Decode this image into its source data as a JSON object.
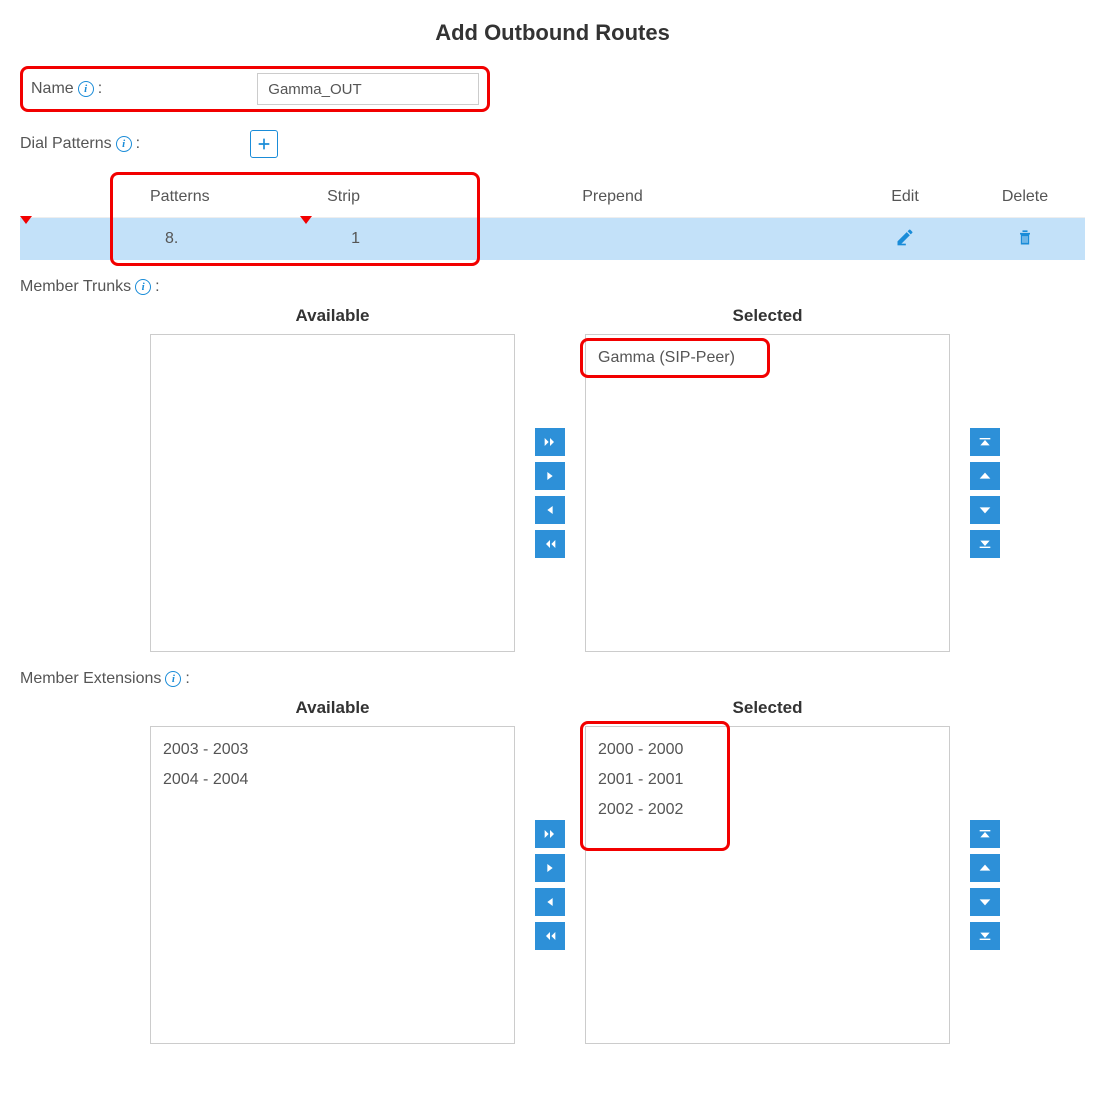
{
  "title": "Add Outbound Routes",
  "fields": {
    "name_label": "Name",
    "name_value": "Gamma_OUT",
    "dial_patterns_label": "Dial Patterns",
    "member_trunks_label": "Member Trunks",
    "member_extensions_label": "Member Extensions"
  },
  "dial_patterns_table": {
    "headers": {
      "patterns": "Patterns",
      "strip": "Strip",
      "prepend": "Prepend",
      "edit": "Edit",
      "delete": "Delete"
    },
    "rows": [
      {
        "pattern": "8.",
        "strip": "1",
        "prepend": ""
      }
    ]
  },
  "dual_headers": {
    "available": "Available",
    "selected": "Selected"
  },
  "trunks": {
    "available": [],
    "selected": [
      "Gamma (SIP-Peer)"
    ]
  },
  "extensions": {
    "available": [
      "2003 - 2003",
      "2004 - 2004"
    ],
    "selected": [
      "2000 - 2000",
      "2001 - 2001",
      "2002 - 2002"
    ]
  },
  "colors": {
    "accent": "#1a8cd8",
    "highlight": "#f20000",
    "row_bg": "#c3e1f9"
  }
}
